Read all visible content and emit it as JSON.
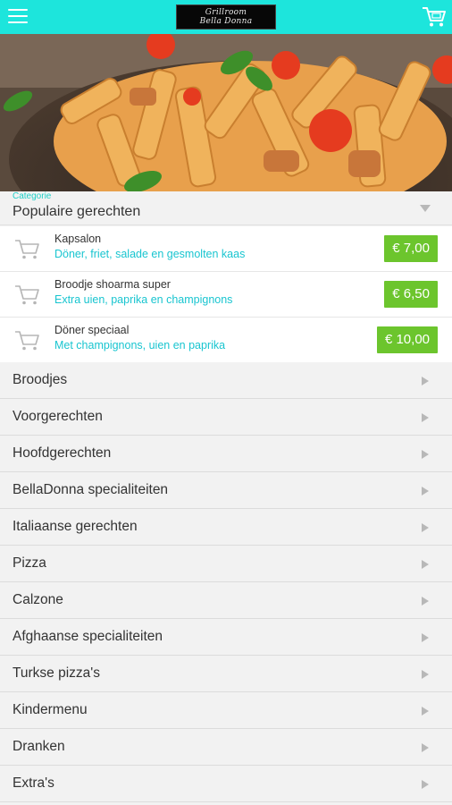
{
  "header": {
    "logo_line1": "Grillroom",
    "logo_line2": "Bella Donna",
    "icons": {
      "menu": "hamburger-menu-icon",
      "cart": "shopping-cart-icon"
    },
    "color": "#1de5dc"
  },
  "category_selector": {
    "caption": "Categorie",
    "value": "Populaire gerechten"
  },
  "popular_items": [
    {
      "name": "Kapsalon",
      "description": "Döner, friet, salade en gesmolten kaas",
      "price": "€ 7,00"
    },
    {
      "name": "Broodje shoarma super",
      "description": "Extra uien, paprika en champignons",
      "price": "€ 6,50"
    },
    {
      "name": "Döner speciaal",
      "description": "Met champignons, uien en paprika",
      "price": "€ 10,00"
    }
  ],
  "categories": [
    "Broodjes",
    "Voorgerechten",
    "Hoofdgerechten",
    "BellaDonna specialiteiten",
    "Italiaanse gerechten",
    "Pizza",
    "Calzone",
    "Afghaanse specialiteiten",
    "Turkse pizza's",
    "Kindermenu",
    "Dranken",
    "Extra's"
  ],
  "colors": {
    "accent": "#1de5dc",
    "price_badge": "#6cc52d",
    "description": "#19c5d0"
  }
}
